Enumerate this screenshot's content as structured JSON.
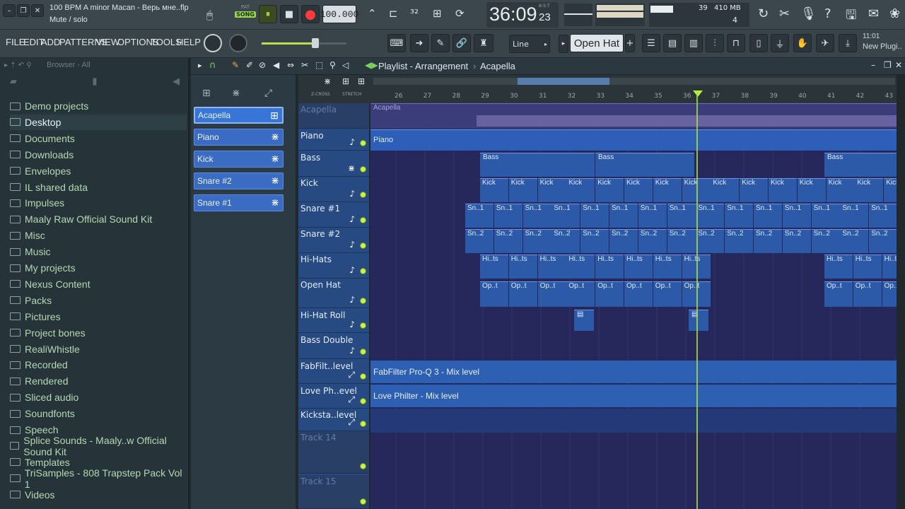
{
  "project": {
    "title": "100 BPM A minor Macan - Верь мне..flp",
    "hint": "Mute / solo"
  },
  "transport": {
    "mode": "SONG",
    "pat_label": "PAT",
    "tempo": "100.000",
    "time": "36:09",
    "time_sub": "23",
    "time_unit": "B:S:T"
  },
  "monitor": {
    "cpu": "39",
    "memory": "410 MB",
    "voices": "4"
  },
  "menu": [
    "FILE",
    "EDIT",
    "ADD",
    "PATTERNS",
    "VIEW",
    "OPTIONS",
    "TOOLS",
    "HELP"
  ],
  "toolbar": {
    "snap": "Line",
    "channel": "Open Hat",
    "plugin_time": "11:01",
    "plugin_label": "New Plugi.."
  },
  "browser": {
    "title": "Browser - All",
    "items": [
      "Demo projects",
      "Desktop",
      "Documents",
      "Downloads",
      "Envelopes",
      "IL shared data",
      "Impulses",
      "Maaly Raw Official Sound Kit",
      "Misc",
      "Music",
      "My projects",
      "Nexus Content",
      "Packs",
      "Pictures",
      "Project bones",
      "RealiWhistle",
      "Recorded",
      "Rendered",
      "Sliced audio",
      "Soundfonts",
      "Speech",
      "Splice Sounds - Maaly..w Official Sound Kit",
      "Templates",
      "TriSamples - 808 Trapstep Pack Vol 1",
      "Videos"
    ]
  },
  "channels": [
    "Acapella",
    "Piano",
    "Kick",
    "Snare #2",
    "Snare #1"
  ],
  "playlist": {
    "title": "Playlist - Arrangement",
    "pattern": "Acapella",
    "zcross": "Z-CROSS",
    "stretch": "STRETCH"
  },
  "bars": [
    "26",
    "27",
    "28",
    "29",
    "30",
    "31",
    "32",
    "33",
    "34",
    "35",
    "36",
    "37",
    "38",
    "39",
    "40",
    "41",
    "42",
    "43"
  ],
  "tracks": [
    "Acapella",
    "Piano",
    "Bass",
    "Kick",
    "Snare #1",
    "Snare #2",
    "Hi-Hats",
    "Open Hat",
    "Hi-Hat Roll",
    "Bass Double",
    "FabFilt..level",
    "Love Ph..evel",
    "Kicksta..level",
    "Track 14",
    "Track 15"
  ],
  "clips": {
    "acapella": "Acapella",
    "piano": "Piano",
    "bass": "Bass",
    "kick": "Kick",
    "snare1": "Sn..1",
    "snare2": "Sn..2",
    "hihats": "Hi..ts",
    "openhat": "Op..t",
    "fabfilter": "FabFilter Pro-Q 3 - Mix level",
    "lovephilter": "Love Philter - Mix level"
  }
}
